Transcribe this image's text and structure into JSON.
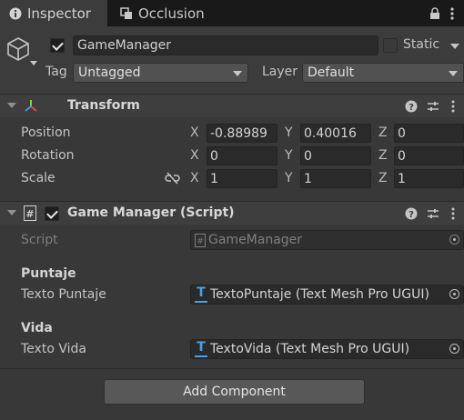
{
  "tabs": [
    {
      "label": "Inspector"
    },
    {
      "label": "Occlusion"
    }
  ],
  "gameobject": {
    "name": "GameManager",
    "static_label": "Static",
    "tag_label": "Tag",
    "tag_value": "Untagged",
    "layer_label": "Layer",
    "layer_value": "Default"
  },
  "transform": {
    "title": "Transform",
    "position_label": "Position",
    "rotation_label": "Rotation",
    "scale_label": "Scale",
    "axis_x": "X",
    "axis_y": "Y",
    "axis_z": "Z",
    "position": {
      "x": "-0.88989",
      "y": "0.40016",
      "z": "0"
    },
    "rotation": {
      "x": "0",
      "y": "0",
      "z": "0"
    },
    "scale": {
      "x": "1",
      "y": "1",
      "z": "1"
    }
  },
  "script_component": {
    "title": "Game Manager (Script)",
    "script_label": "Script",
    "script_value": "GameManager",
    "puntaje_header": "Puntaje",
    "texto_puntaje_label": "Texto Puntaje",
    "texto_puntaje_value": "TextoPuntaje (Text Mesh Pro UGUI)",
    "vida_header": "Vida",
    "texto_vida_label": "Texto Vida",
    "texto_vida_value": "TextoVida (Text Mesh Pro UGUI)"
  },
  "add_component_label": "Add Component",
  "colors": {
    "accent_blue": "#4aa0e6",
    "panel": "#383838",
    "tabbar": "#191919"
  }
}
